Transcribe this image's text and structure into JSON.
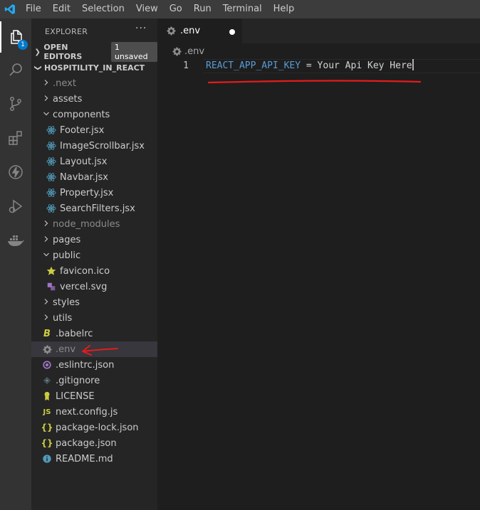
{
  "menu": [
    "File",
    "Edit",
    "Selection",
    "View",
    "Go",
    "Run",
    "Terminal",
    "Help"
  ],
  "activity": {
    "explorer_badge": "1"
  },
  "sidebar": {
    "title": "EXPLORER",
    "more": "···",
    "open_editors": {
      "label": "OPEN EDITORS",
      "badge": "1 unsaved"
    },
    "project": {
      "label": "HOSPITILITY_IN_REACT"
    },
    "items": [
      {
        "label": ".next",
        "kind": "folder",
        "expanded": false,
        "depth": 1,
        "dim": true
      },
      {
        "label": "assets",
        "kind": "folder",
        "expanded": false,
        "depth": 1
      },
      {
        "label": "components",
        "kind": "folder",
        "expanded": true,
        "depth": 1
      },
      {
        "label": "Footer.jsx",
        "kind": "react",
        "depth": 2
      },
      {
        "label": "ImageScrollbar.jsx",
        "kind": "react",
        "depth": 2
      },
      {
        "label": "Layout.jsx",
        "kind": "react",
        "depth": 2
      },
      {
        "label": "Navbar.jsx",
        "kind": "react",
        "depth": 2
      },
      {
        "label": "Property.jsx",
        "kind": "react",
        "depth": 2
      },
      {
        "label": "SearchFilters.jsx",
        "kind": "react",
        "depth": 2
      },
      {
        "label": "node_modules",
        "kind": "folder",
        "expanded": false,
        "depth": 1,
        "dim": true
      },
      {
        "label": "pages",
        "kind": "folder",
        "expanded": false,
        "depth": 1
      },
      {
        "label": "public",
        "kind": "folder",
        "expanded": true,
        "depth": 1
      },
      {
        "label": "favicon.ico",
        "kind": "star",
        "depth": 2
      },
      {
        "label": "vercel.svg",
        "kind": "svg",
        "depth": 2
      },
      {
        "label": "styles",
        "kind": "folder",
        "expanded": false,
        "depth": 1
      },
      {
        "label": "utils",
        "kind": "folder",
        "expanded": false,
        "depth": 1
      },
      {
        "label": ".babelrc",
        "kind": "babel",
        "depth": 1
      },
      {
        "label": ".env",
        "kind": "gear",
        "depth": 1,
        "selected": true,
        "dim": true
      },
      {
        "label": ".eslintrc.json",
        "kind": "eslint",
        "depth": 1
      },
      {
        "label": ".gitignore",
        "kind": "git",
        "depth": 1
      },
      {
        "label": "LICENSE",
        "kind": "license",
        "depth": 1
      },
      {
        "label": "next.config.js",
        "kind": "js",
        "depth": 1
      },
      {
        "label": "package-lock.json",
        "kind": "json",
        "depth": 1
      },
      {
        "label": "package.json",
        "kind": "json",
        "depth": 1
      },
      {
        "label": "README.md",
        "kind": "info",
        "depth": 1
      }
    ]
  },
  "editor": {
    "tab": {
      "label": ".env"
    },
    "breadcrumb": ".env",
    "line_number": "1",
    "code": {
      "key": "REACT_APP_API_KEY",
      "eq": " = ",
      "value": "Your Api Key Here"
    }
  },
  "colors": {
    "accent": "#007acc",
    "key_token": "#569cd6",
    "annotation": "#e51b1b"
  }
}
